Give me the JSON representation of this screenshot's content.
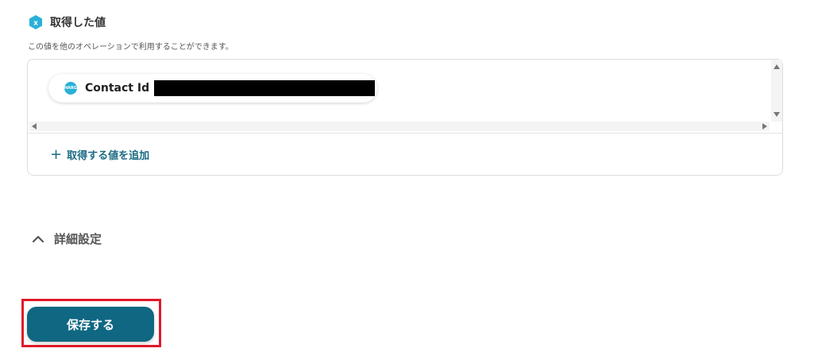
{
  "section": {
    "title": "取得した値",
    "description": "この値を他のオペレーションで利用することができます。"
  },
  "values": [
    {
      "label": "Contact Id",
      "icon_text": "HARG"
    }
  ],
  "add_value_label": "取得する値を追加",
  "advanced_settings_label": "詳細設定",
  "save_label": "保存する",
  "colors": {
    "accent": "#0f6782",
    "link": "#1b6b84",
    "highlight": "#e0192b",
    "icon": "#2ab0d8"
  }
}
